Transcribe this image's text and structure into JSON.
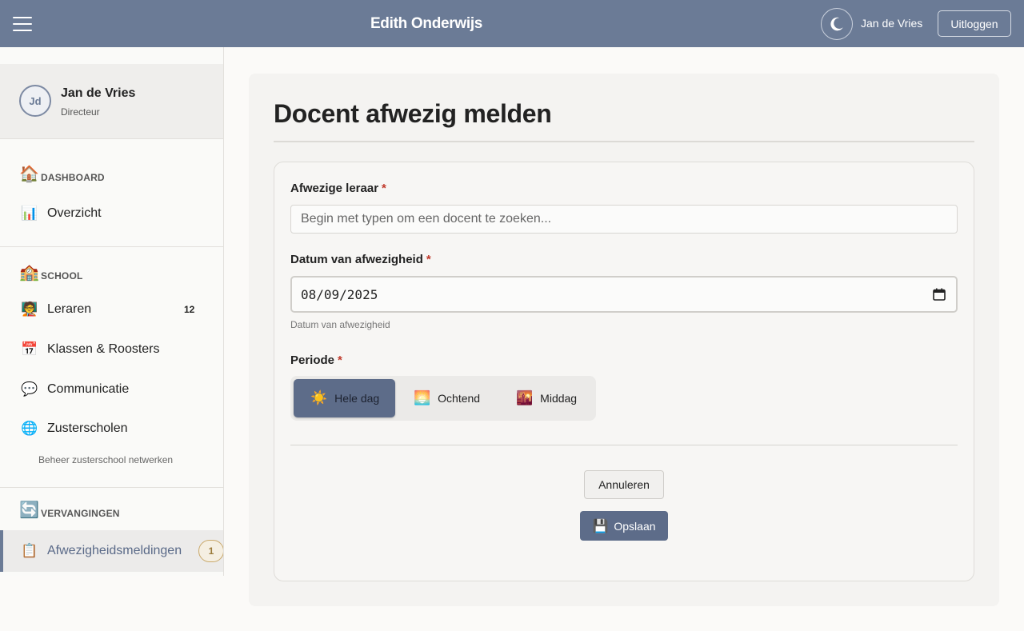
{
  "header": {
    "title": "Edith Onderwijs",
    "user_name": "Jan de Vries",
    "logout_label": "Uitloggen",
    "theme_icon": "moon-icon",
    "menu_icon": "hamburger-menu-icon"
  },
  "sidebar": {
    "profile": {
      "initials": "Jd",
      "name": "Jan de Vries",
      "role": "Directeur"
    },
    "sections": {
      "dashboard": {
        "emoji": "🏠",
        "label": "DASHBOARD"
      },
      "school": {
        "emoji": "🏫",
        "label": "SCHOOL"
      },
      "vervangingen": {
        "emoji": "🔄",
        "label": "VERVANGINGEN"
      }
    },
    "items": {
      "overzicht": {
        "emoji": "📊",
        "label": "Overzicht"
      },
      "leraren": {
        "emoji": "🧑‍🏫",
        "label": "Leraren",
        "count": "12"
      },
      "klassen": {
        "emoji": "📅",
        "label": "Klassen & Roosters"
      },
      "communicatie": {
        "emoji": "💬",
        "label": "Communicatie"
      },
      "zusterscholen": {
        "emoji": "🌐",
        "label": "Zusterscholen",
        "subtitle": "Beheer zusterschool netwerken"
      },
      "afwezigheid": {
        "emoji": "📋",
        "label": "Afwezigheidsmeldingen",
        "badge": "1"
      }
    }
  },
  "main": {
    "page_title": "Docent afwezig melden",
    "form": {
      "teacher_label": "Afwezige leraar",
      "teacher_placeholder": "Begin met typen om een docent te zoeken...",
      "date_label": "Datum van afwezigheid",
      "date_value": "08/09/2025",
      "date_help": "Datum van afwezigheid",
      "period_label": "Periode",
      "required_mark": "*",
      "periods": [
        {
          "emoji": "☀️",
          "label": "Hele dag",
          "selected": true
        },
        {
          "emoji": "🌅",
          "label": "Ochtend",
          "selected": false
        },
        {
          "emoji": "🌇",
          "label": "Middag",
          "selected": false
        }
      ],
      "cancel_label": "Annuleren",
      "save_label": "Opslaan",
      "save_emoji": "💾"
    }
  },
  "colors": {
    "header_bg": "#6b7b96",
    "accent": "#5d6c89",
    "required": "#c0392b"
  }
}
